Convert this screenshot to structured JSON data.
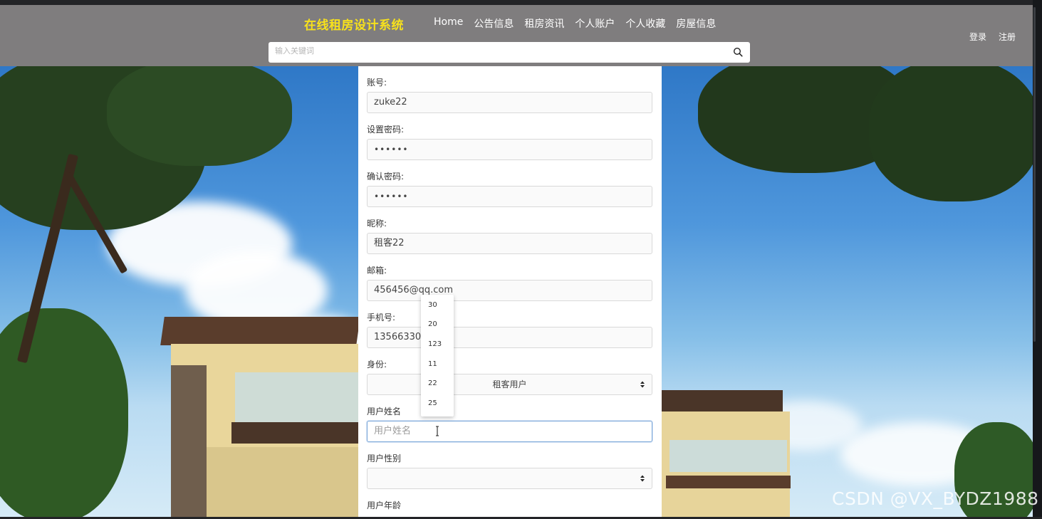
{
  "header": {
    "brand": "在线租房设计系统",
    "nav": [
      {
        "label": "Home"
      },
      {
        "label": "公告信息"
      },
      {
        "label": "租房资讯"
      },
      {
        "label": "个人账户"
      },
      {
        "label": "个人收藏"
      },
      {
        "label": "房屋信息"
      }
    ],
    "login_label": "登录",
    "register_label": "注册",
    "search_placeholder": "输入关键词"
  },
  "form": {
    "account_label": "账号:",
    "account_value": "zuke22",
    "password_label": "设置密码:",
    "password_value": "••••••",
    "confirm_label": "确认密码:",
    "confirm_value": "••••••",
    "nickname_label": "昵称:",
    "nickname_value": "租客22",
    "email_label": "邮箱:",
    "email_value": "456456@qq.com",
    "phone_label": "手机号:",
    "phone_value": "1356633000",
    "role_label": "身份:",
    "role_value": "租客用户",
    "name_label": "用户姓名",
    "name_placeholder": "用户姓名",
    "gender_label": "用户性别",
    "gender_value": "",
    "age_label": "用户年龄"
  },
  "autocomplete": {
    "items": [
      "30",
      "20",
      "123",
      "11",
      "22",
      "25"
    ]
  },
  "watermark": "CSDN @VX_BYDZ1988",
  "colors": {
    "header_bg": "#7f7d7e",
    "brand": "#f7e11c",
    "focus_border": "#7aa7d8"
  }
}
